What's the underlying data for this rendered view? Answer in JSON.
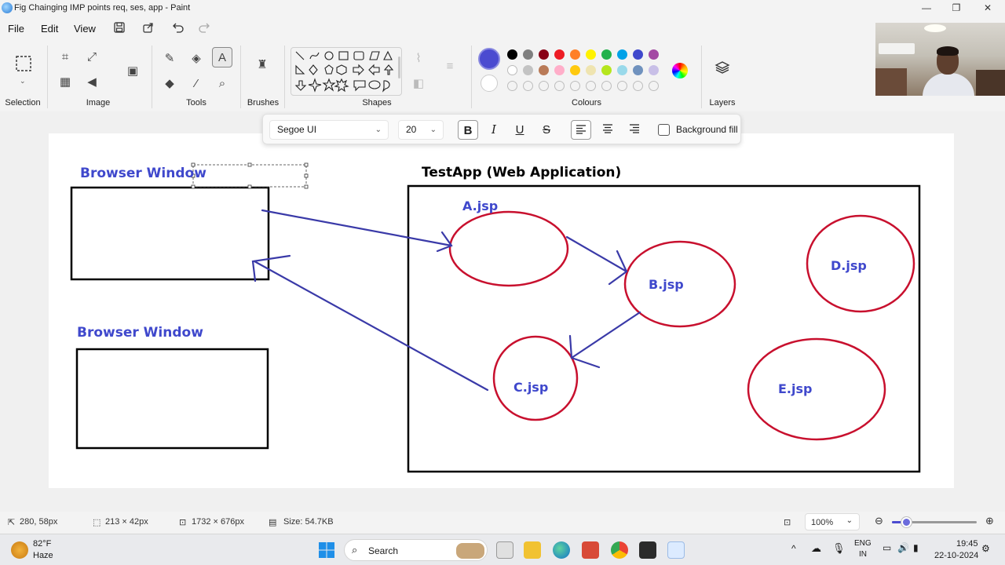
{
  "window": {
    "title": "Fig Chainging IMP points req, ses, app - Paint",
    "minimize": "—",
    "maximize": "❐",
    "close": "✕"
  },
  "menu": {
    "file": "File",
    "edit": "Edit",
    "view": "View"
  },
  "ribbon": {
    "groups": {
      "selection": "Selection",
      "image": "Image",
      "tools": "Tools",
      "brushes": "Brushes",
      "shapes": "Shapes",
      "colours": "Colours",
      "layers": "Layers"
    },
    "active_colour": "#4b4bd0",
    "secondary_colour": "#ffffff",
    "palette_row1": [
      "#000000",
      "#7f7f7f",
      "#880015",
      "#ed1c24",
      "#ff7f27",
      "#fff200",
      "#22b14c",
      "#00a2e8",
      "#3f48cc",
      "#a349a4"
    ],
    "palette_row2": [
      "#ffffff",
      "#c3c3c3",
      "#b97a57",
      "#ffaec9",
      "#ffc90e",
      "#efe4b0",
      "#b5e61d",
      "#99d9ea",
      "#7092be",
      "#c8bfe7"
    ]
  },
  "text_toolbar": {
    "font": "Segoe UI",
    "size": "20",
    "bold": "B",
    "italic": "I",
    "underline": "U",
    "strikethrough": "S",
    "background_fill": "Background fill"
  },
  "drawing": {
    "labels": {
      "browser_window_1": "Browser Window",
      "browser_window_2": "Browser Window",
      "testapp": "TestApp (Web Application)",
      "a": "A.jsp",
      "b": "B.jsp",
      "c": "C.jsp",
      "d": "D.jsp",
      "e": "E.jsp"
    },
    "colors": {
      "label_blue": "#3f48cc",
      "ellipse_red": "#c8102e",
      "arrow_blue": "#3a3aa8",
      "box_black": "#000000"
    }
  },
  "status": {
    "cursor": "280, 58px",
    "selection": "213 × 42px",
    "canvas_size": "1732 × 676px",
    "file_size": "Size: 54.7KB",
    "zoom": "100%"
  },
  "taskbar": {
    "weather_temp": "82°F",
    "weather_desc": "Haze",
    "search": "Search",
    "lang1": "ENG",
    "lang2": "IN",
    "time": "19:45",
    "date": "22-10-2024"
  }
}
